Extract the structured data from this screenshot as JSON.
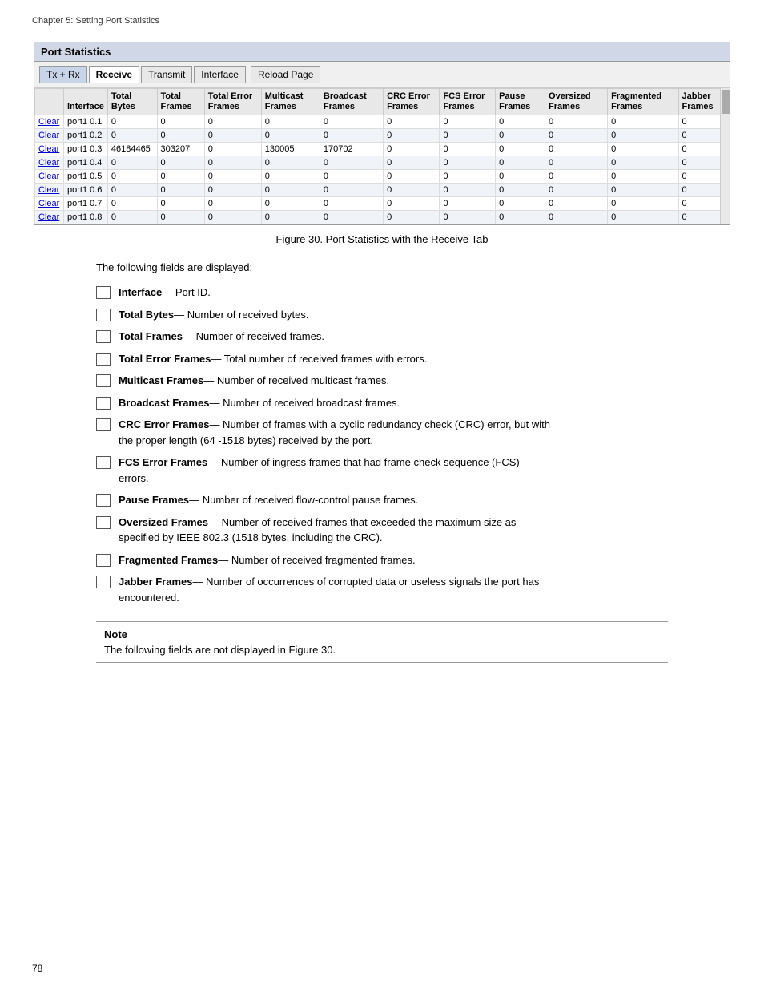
{
  "page": {
    "chapter_header": "Chapter 5: Setting Port Statistics",
    "page_number": "78"
  },
  "port_stats": {
    "title": "Port Statistics",
    "tabs": [
      {
        "label": "Tx + Rx",
        "active": false,
        "special": true
      },
      {
        "label": "Receive",
        "active": true
      },
      {
        "label": "Transmit",
        "active": false
      },
      {
        "label": "Interface",
        "active": false
      }
    ],
    "reload_button": "Reload Page",
    "columns": [
      {
        "key": "clear",
        "label": ""
      },
      {
        "key": "interface",
        "label": "Interface"
      },
      {
        "key": "total_bytes",
        "label": "Total Bytes"
      },
      {
        "key": "total_frames",
        "label": "Total Frames"
      },
      {
        "key": "total_error_frames",
        "label": "Total Error Frames"
      },
      {
        "key": "multicast_frames",
        "label": "Multicast Frames"
      },
      {
        "key": "broadcast_frames",
        "label": "Broadcast Frames"
      },
      {
        "key": "crc_error_frames",
        "label": "CRC Error Frames"
      },
      {
        "key": "fcs_error_frames",
        "label": "FCS Error Frames"
      },
      {
        "key": "pause_frames",
        "label": "Pause Frames"
      },
      {
        "key": "oversized_frames",
        "label": "Oversized Frames"
      },
      {
        "key": "fragmented_frames",
        "label": "Fragmented Frames"
      },
      {
        "key": "jabber_frames",
        "label": "Jabber Frames"
      }
    ],
    "rows": [
      {
        "clear": "Clear",
        "interface": "port1 0.1",
        "total_bytes": "0",
        "total_frames": "0",
        "total_error_frames": "0",
        "multicast_frames": "0",
        "broadcast_frames": "0",
        "crc_error_frames": "0",
        "fcs_error_frames": "0",
        "pause_frames": "0",
        "oversized_frames": "0",
        "fragmented_frames": "0",
        "jabber_frames": "0"
      },
      {
        "clear": "Clear",
        "interface": "port1 0.2",
        "total_bytes": "0",
        "total_frames": "0",
        "total_error_frames": "0",
        "multicast_frames": "0",
        "broadcast_frames": "0",
        "crc_error_frames": "0",
        "fcs_error_frames": "0",
        "pause_frames": "0",
        "oversized_frames": "0",
        "fragmented_frames": "0",
        "jabber_frames": "0"
      },
      {
        "clear": "Clear",
        "interface": "port1 0.3",
        "total_bytes": "46184465",
        "total_frames": "303207",
        "total_error_frames": "0",
        "multicast_frames": "130005",
        "broadcast_frames": "170702",
        "crc_error_frames": "0",
        "fcs_error_frames": "0",
        "pause_frames": "0",
        "oversized_frames": "0",
        "fragmented_frames": "0",
        "jabber_frames": "0"
      },
      {
        "clear": "Clear",
        "interface": "port1 0.4",
        "total_bytes": "0",
        "total_frames": "0",
        "total_error_frames": "0",
        "multicast_frames": "0",
        "broadcast_frames": "0",
        "crc_error_frames": "0",
        "fcs_error_frames": "0",
        "pause_frames": "0",
        "oversized_frames": "0",
        "fragmented_frames": "0",
        "jabber_frames": "0"
      },
      {
        "clear": "Clear",
        "interface": "port1 0.5",
        "total_bytes": "0",
        "total_frames": "0",
        "total_error_frames": "0",
        "multicast_frames": "0",
        "broadcast_frames": "0",
        "crc_error_frames": "0",
        "fcs_error_frames": "0",
        "pause_frames": "0",
        "oversized_frames": "0",
        "fragmented_frames": "0",
        "jabber_frames": "0"
      },
      {
        "clear": "Clear",
        "interface": "port1 0.6",
        "total_bytes": "0",
        "total_frames": "0",
        "total_error_frames": "0",
        "multicast_frames": "0",
        "broadcast_frames": "0",
        "crc_error_frames": "0",
        "fcs_error_frames": "0",
        "pause_frames": "0",
        "oversized_frames": "0",
        "fragmented_frames": "0",
        "jabber_frames": "0"
      },
      {
        "clear": "Clear",
        "interface": "port1 0.7",
        "total_bytes": "0",
        "total_frames": "0",
        "total_error_frames": "0",
        "multicast_frames": "0",
        "broadcast_frames": "0",
        "crc_error_frames": "0",
        "fcs_error_frames": "0",
        "pause_frames": "0",
        "oversized_frames": "0",
        "fragmented_frames": "0",
        "jabber_frames": "0"
      },
      {
        "clear": "Clear",
        "interface": "port1 0.8",
        "total_bytes": "0",
        "total_frames": "0",
        "total_error_frames": "0",
        "multicast_frames": "0",
        "broadcast_frames": "0",
        "crc_error_frames": "0",
        "fcs_error_frames": "0",
        "pause_frames": "0",
        "oversized_frames": "0",
        "fragmented_frames": "0",
        "jabber_frames": "0"
      }
    ]
  },
  "figure_caption": "Figure 30. Port Statistics with the Receive Tab",
  "following_fields_text": "The following fields are displayed:",
  "fields": [
    {
      "bold": "Interface",
      "rest": "— Port ID."
    },
    {
      "bold": "Total Bytes",
      "rest": "— Number of received bytes."
    },
    {
      "bold": "Total Frames",
      "rest": "— Number of received frames."
    },
    {
      "bold": "Total Error Frames",
      "rest": "— Total number of received frames with errors."
    },
    {
      "bold": "Multicast Frames",
      "rest": "— Number of received multicast frames."
    },
    {
      "bold": "Broadcast Frames",
      "rest": "— Number of received broadcast frames."
    },
    {
      "bold": "CRC Error Frames",
      "rest": "— Number of frames with a cyclic redundancy check (CRC) error, but with the proper length (64 -1518 bytes) received by the port."
    },
    {
      "bold": "FCS Error Frames",
      "rest": "— Number of ingress frames that had frame check sequence (FCS) errors."
    },
    {
      "bold": "Pause Frames",
      "rest": "— Number of received flow-control pause frames."
    },
    {
      "bold": "Oversized Frames",
      "rest": "— Number of received frames that exceeded the maximum size as specified by IEEE 802.3 (1518 bytes, including the CRC)."
    },
    {
      "bold": "Fragmented Frames",
      "rest": "— Number of received fragmented frames."
    },
    {
      "bold": "Jabber Frames",
      "rest": "— Number of occurrences of corrupted data or useless signals the port has encountered."
    }
  ],
  "note": {
    "title": "Note",
    "text": "The following fields are not displayed in Figure 30."
  }
}
